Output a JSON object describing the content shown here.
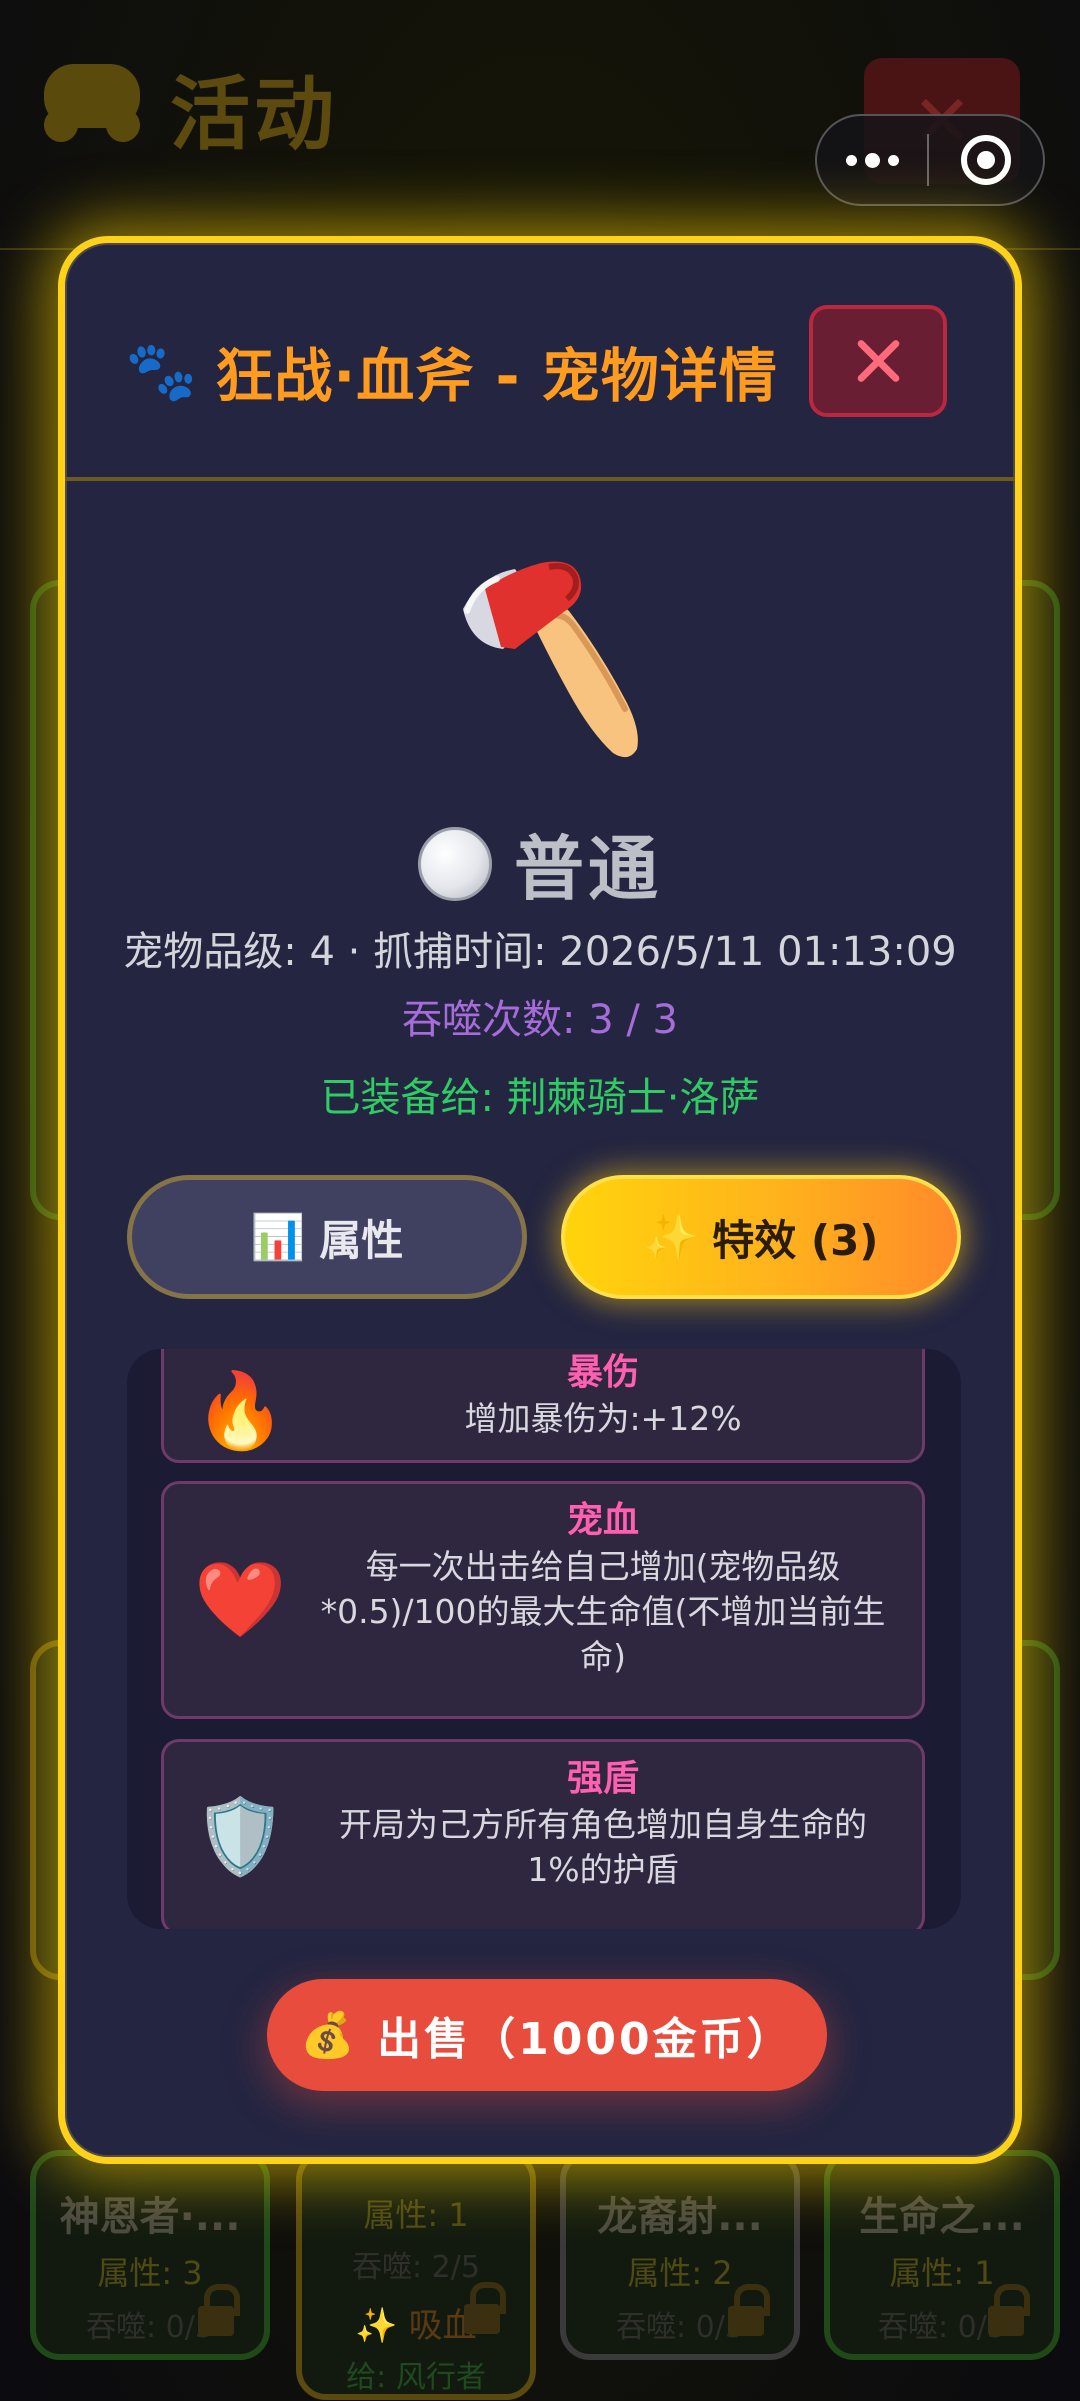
{
  "background": {
    "page_title": "活动",
    "cards": [
      {
        "name": "神恩者·...",
        "attr": "属性: 3",
        "eat": "吞噬: 0/5"
      },
      {
        "attr": "属性: 1",
        "eat": "吞噬: 2/5",
        "skill": "✨ 吸血",
        "give": "给: 风行者"
      },
      {
        "name": "龙裔射...",
        "attr": "属性: 2",
        "eat": "吞噬: 0/5"
      },
      {
        "name": "生命之...",
        "attr": "属性: 1",
        "eat": "吞噬: 0/5"
      }
    ]
  },
  "capsule": {
    "menu_icon": "more-dots-icon",
    "target_icon": "target-icon"
  },
  "modal": {
    "paw_icon": "🐾",
    "title": "狂战·血斧 - 宠物详情",
    "close_icon": "close-icon",
    "pet_icon": "axe-icon",
    "rarity": "普通",
    "grade_line": "宠物品级: 4 · 抓捕时间: 2026/5/11 01:13:09",
    "devour_line": "吞噬次数: 3 / 3",
    "equipped_line": "已装备给: 荆棘骑士·洛萨",
    "tabs": [
      {
        "icon": "📊",
        "label": "属性",
        "active": false
      },
      {
        "icon": "✨",
        "label": "特效 (3)",
        "active": true
      }
    ],
    "effects": [
      {
        "icon": "🔥",
        "name": "暴伤",
        "desc": "增加暴伤为:+12%"
      },
      {
        "icon": "❤️",
        "name": "宠血",
        "desc": "每一次出击给自己增加(宠物品级*0.5)/100的最大生命值(不增加当前生命)"
      },
      {
        "icon": "🛡️",
        "name": "强盾",
        "desc": "开局为己方所有角色增加自身生命的1%的护盾"
      }
    ],
    "sell": {
      "icon": "💰",
      "label": "出售（1000金币）"
    }
  }
}
